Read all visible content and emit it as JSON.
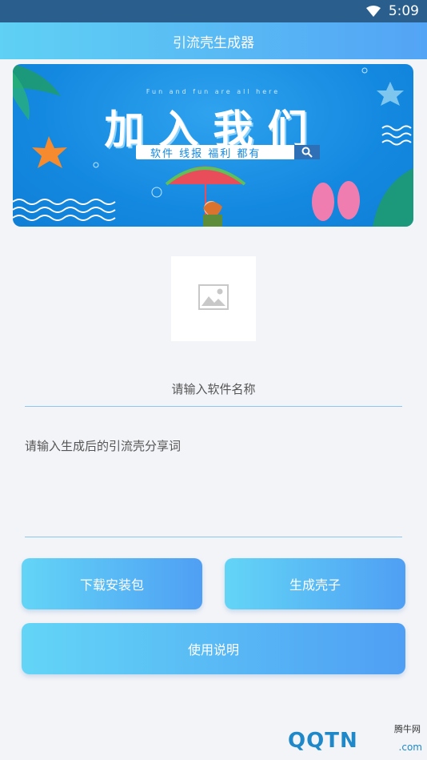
{
  "status_bar": {
    "time": "5:09"
  },
  "app_bar": {
    "title": "引流壳生成器"
  },
  "banner": {
    "subtitle": "Fun and fun are all here",
    "title": "加入我们",
    "search_text": "软件 线报 福利 都有"
  },
  "form": {
    "name_placeholder": "请输入软件名称",
    "share_placeholder": "请输入生成后的引流壳分享词"
  },
  "buttons": {
    "download": "下载安装包",
    "generate": "生成壳子",
    "usage": "使用说明"
  },
  "watermark": {
    "cn": "腾牛网",
    "en": "QQTN",
    "domain": ".com"
  },
  "colors": {
    "accent_start": "#5fd1f4",
    "accent_end": "#53a4f5",
    "banner_blue": "#1489e0"
  }
}
